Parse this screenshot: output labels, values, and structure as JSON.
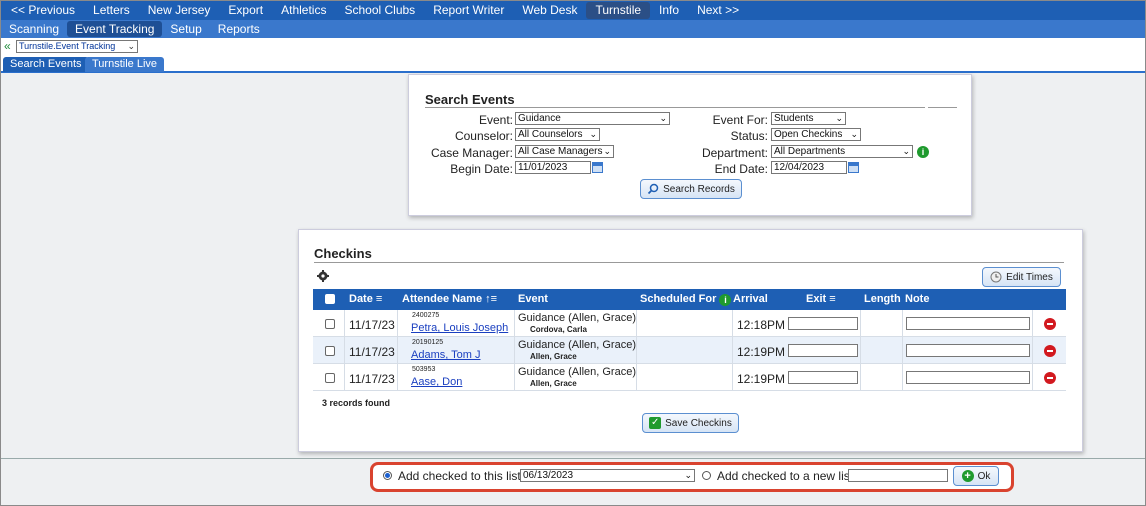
{
  "topnav": {
    "items": [
      "<< Previous",
      "Letters",
      "New Jersey",
      "Export",
      "Athletics",
      "School Clubs",
      "Report Writer",
      "Web Desk",
      "Turnstile",
      "Info",
      "Next >>"
    ],
    "active_index": 8
  },
  "subnav": {
    "items": [
      "Scanning",
      "Event Tracking",
      "Setup",
      "Reports"
    ],
    "active_index": 1
  },
  "crumb": {
    "select_value": "Turnstile.Event Tracking"
  },
  "tabs": [
    "Search Events",
    "Turnstile Live"
  ],
  "search": {
    "title": "Search Events",
    "event_label": "Event:",
    "event_value": "Guidance",
    "counselor_label": "Counselor:",
    "counselor_value": "All Counselors",
    "case_manager_label": "Case Manager:",
    "case_manager_value": "All Case Managers",
    "begin_date_label": "Begin Date:",
    "begin_date_value": "11/01/2023",
    "event_for_label": "Event For:",
    "event_for_value": "Students",
    "status_label": "Status:",
    "status_value": "Open Checkins",
    "department_label": "Department:",
    "department_value": "All Departments",
    "end_date_label": "End Date:",
    "end_date_value": "12/04/2023",
    "search_button": "Search Records"
  },
  "checkins": {
    "title": "Checkins",
    "edit_times_button": "Edit Times",
    "columns": {
      "date": "Date",
      "attendee": "Attendee Name",
      "event": "Event",
      "scheduled_for": "Scheduled For",
      "arrival": "Arrival",
      "exit": "Exit",
      "length": "Length",
      "note": "Note"
    },
    "rows": [
      {
        "date": "11/17/23",
        "id": "2400275",
        "name": "Petra, Louis Joseph",
        "event": "Guidance (Allen, Grace)",
        "staff": "Cordova, Carla",
        "arrival": "12:18PM"
      },
      {
        "date": "11/17/23",
        "id": "20190125",
        "name": "Adams, Tom J",
        "event": "Guidance (Allen, Grace)",
        "staff": "Allen, Grace",
        "arrival": "12:19PM"
      },
      {
        "date": "11/17/23",
        "id": "503953",
        "name": "Aase, Don",
        "event": "Guidance (Allen, Grace)",
        "staff": "Allen, Grace",
        "arrival": "12:19PM"
      }
    ],
    "records_found": "3 records found",
    "save_button": "Save Checkins"
  },
  "bottom": {
    "add_to_list_label": "Add checked to this list:",
    "list_value": "06/13/2023",
    "add_to_new_label": "Add checked to a new list:",
    "new_list_value": "",
    "ok_button": "Ok"
  },
  "colors": {
    "nav": "#1e5fb4",
    "subnav": "#3a78cc",
    "highlight": "#d9432f"
  }
}
